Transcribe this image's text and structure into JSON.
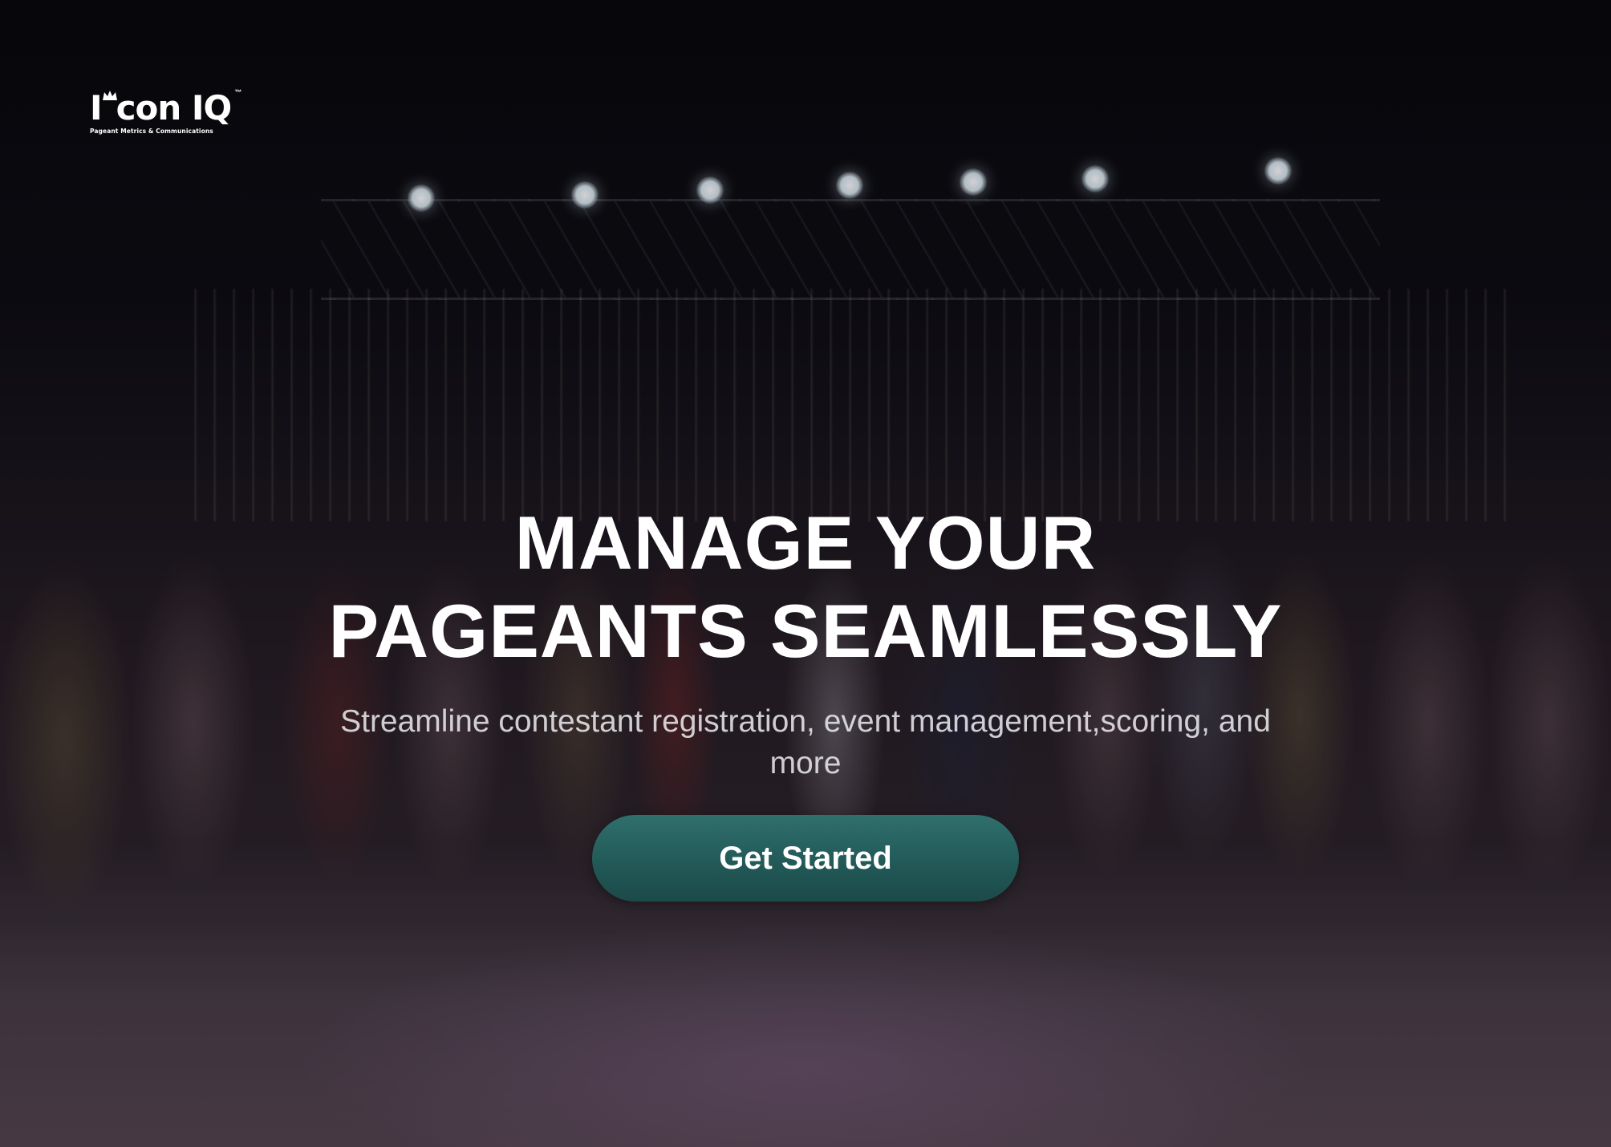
{
  "brand": {
    "name": "I",
    "name_rest": "con IQ",
    "trademark": "™",
    "tagline": "Pageant Metrics & Communications"
  },
  "hero": {
    "title_line1": "MANAGE YOUR",
    "title_line2": "PAGEANTS SEAMLESSLY",
    "subtitle": "Streamline contestant registration, event management,scoring, and more",
    "cta_label": "Get Started"
  },
  "colors": {
    "cta_background": "#225a58",
    "text_primary": "#ffffff"
  }
}
